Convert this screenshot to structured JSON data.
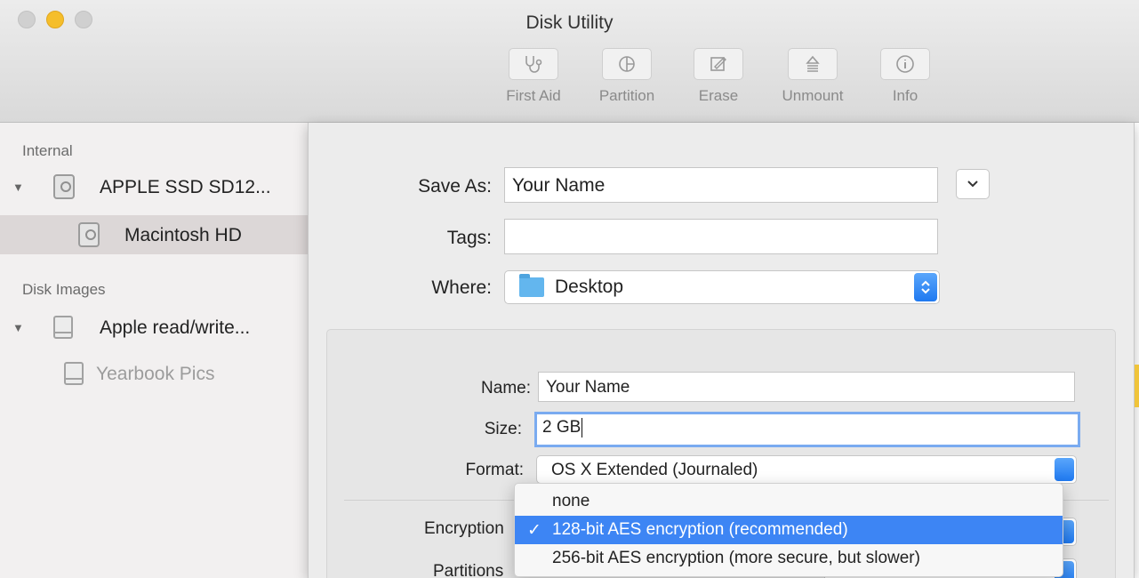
{
  "window": {
    "title": "Disk Utility"
  },
  "toolbar": {
    "first_aid": "First Aid",
    "partition": "Partition",
    "erase": "Erase",
    "unmount": "Unmount",
    "info": "Info"
  },
  "sidebar": {
    "internal_header": "Internal",
    "disk_images_header": "Disk Images",
    "items": [
      {
        "label": "APPLE SSD SD12..."
      },
      {
        "label": "Macintosh HD"
      },
      {
        "label": "Apple read/write..."
      },
      {
        "label": "Yearbook Pics"
      }
    ]
  },
  "sheet": {
    "save_as_label": "Save As:",
    "save_as_value": "Your Name",
    "tags_label": "Tags:",
    "tags_value": "",
    "where_label": "Where:",
    "where_value": "Desktop",
    "name_label": "Name:",
    "name_value": "Your Name",
    "size_label": "Size:",
    "size_value": "2 GB",
    "format_label": "Format:",
    "format_value": "OS X Extended (Journaled)",
    "encryption_label": "Encryption",
    "partitions_label": "Partitions"
  },
  "menu": {
    "items": [
      {
        "label": "none",
        "checked": false
      },
      {
        "label": "128-bit AES encryption (recommended)",
        "checked": true
      },
      {
        "label": "256-bit AES encryption (more secure, but slower)",
        "checked": false
      }
    ],
    "check_glyph": "✓"
  },
  "colors": {
    "accent": "#3d85f4",
    "traffic_yellow": "#f5be2b",
    "folder": "#63b6ee"
  }
}
